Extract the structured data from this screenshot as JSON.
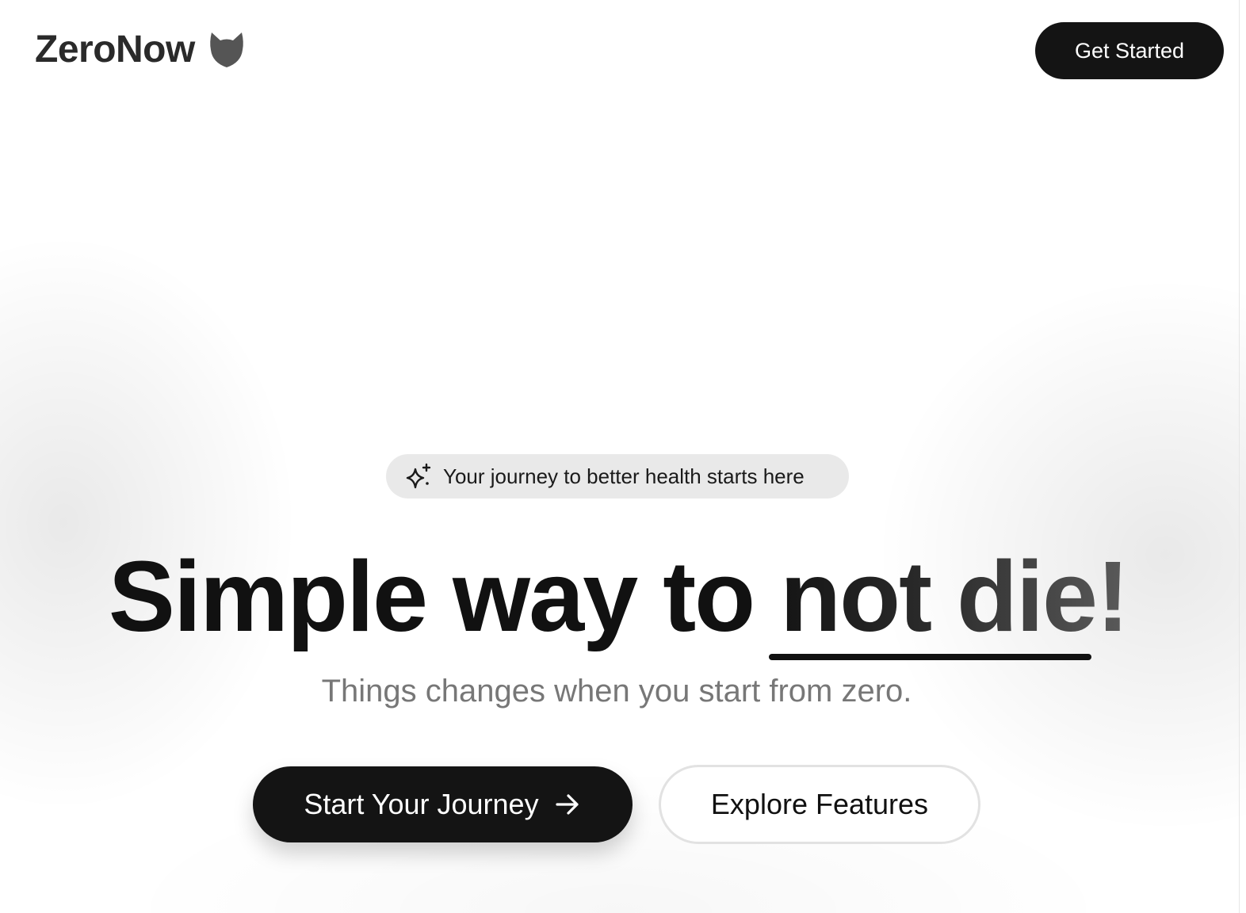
{
  "header": {
    "brand_name": "ZeroNow",
    "brand_icon": "cat-icon",
    "cta_label": "Get Started"
  },
  "hero": {
    "badge_icon": "sparkles-icon",
    "badge_text": "Your journey to better health starts here",
    "headline_prefix": "Simple way to ",
    "headline_accent": "not die!",
    "subtitle": "Things changes when you start from zero.",
    "primary_button_label": "Start Your Journey",
    "primary_button_icon": "arrow-right-icon",
    "secondary_button_label": "Explore Features"
  },
  "colors": {
    "primary": "#141414",
    "background": "#ffffff",
    "badge_bg": "#e9e9e9",
    "subtitle": "#777777"
  }
}
